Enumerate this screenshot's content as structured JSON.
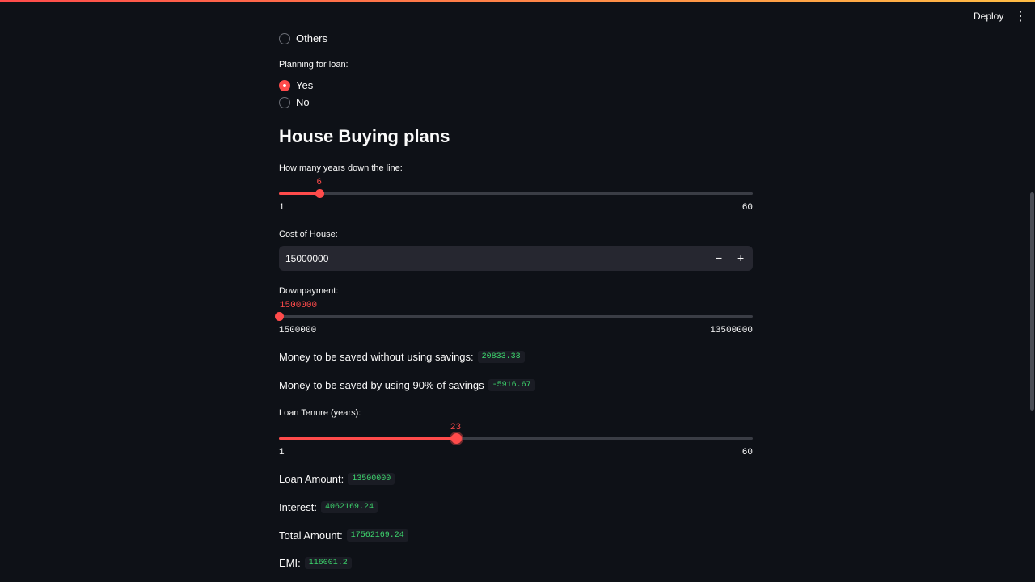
{
  "header": {
    "deploy": "Deploy",
    "menu_icon": "⋮"
  },
  "radio_others": "Others",
  "loan_label": "Planning for loan:",
  "loan_options": [
    {
      "label": "Yes",
      "selected": true
    },
    {
      "label": "No",
      "selected": false
    }
  ],
  "section_title": "House Buying plans",
  "years": {
    "label": "How many years down the line:",
    "value": 6,
    "min": 1,
    "max": 60,
    "value_text": "6",
    "min_text": "1",
    "max_text": "60"
  },
  "cost": {
    "label": "Cost of House:",
    "value": "15000000",
    "minus": "−",
    "plus": "+"
  },
  "downpayment": {
    "label": "Downpayment:",
    "value": 1500000,
    "min": 1500000,
    "max": 13500000,
    "value_text": "1500000",
    "min_text": "1500000",
    "max_text": "13500000"
  },
  "saving1": {
    "label": "Money to be saved without using savings:",
    "value": "20833.33"
  },
  "saving2": {
    "label": "Money to be saved by using 90% of savings",
    "value": "-5916.67"
  },
  "tenure": {
    "label": "Loan Tenure (years):",
    "value": 23,
    "min": 1,
    "max": 60,
    "value_text": "23",
    "min_text": "1",
    "max_text": "60"
  },
  "results": [
    {
      "label": "Loan Amount:",
      "value": "13500000"
    },
    {
      "label": "Interest:",
      "value": "4062169.24"
    },
    {
      "label": "Total Amount:",
      "value": "17562169.24"
    },
    {
      "label": "EMI:",
      "value": "116001.2"
    }
  ],
  "colors": {
    "accent": "#ff4b4b",
    "code": "#3dd56d",
    "bg": "#0e1117"
  }
}
